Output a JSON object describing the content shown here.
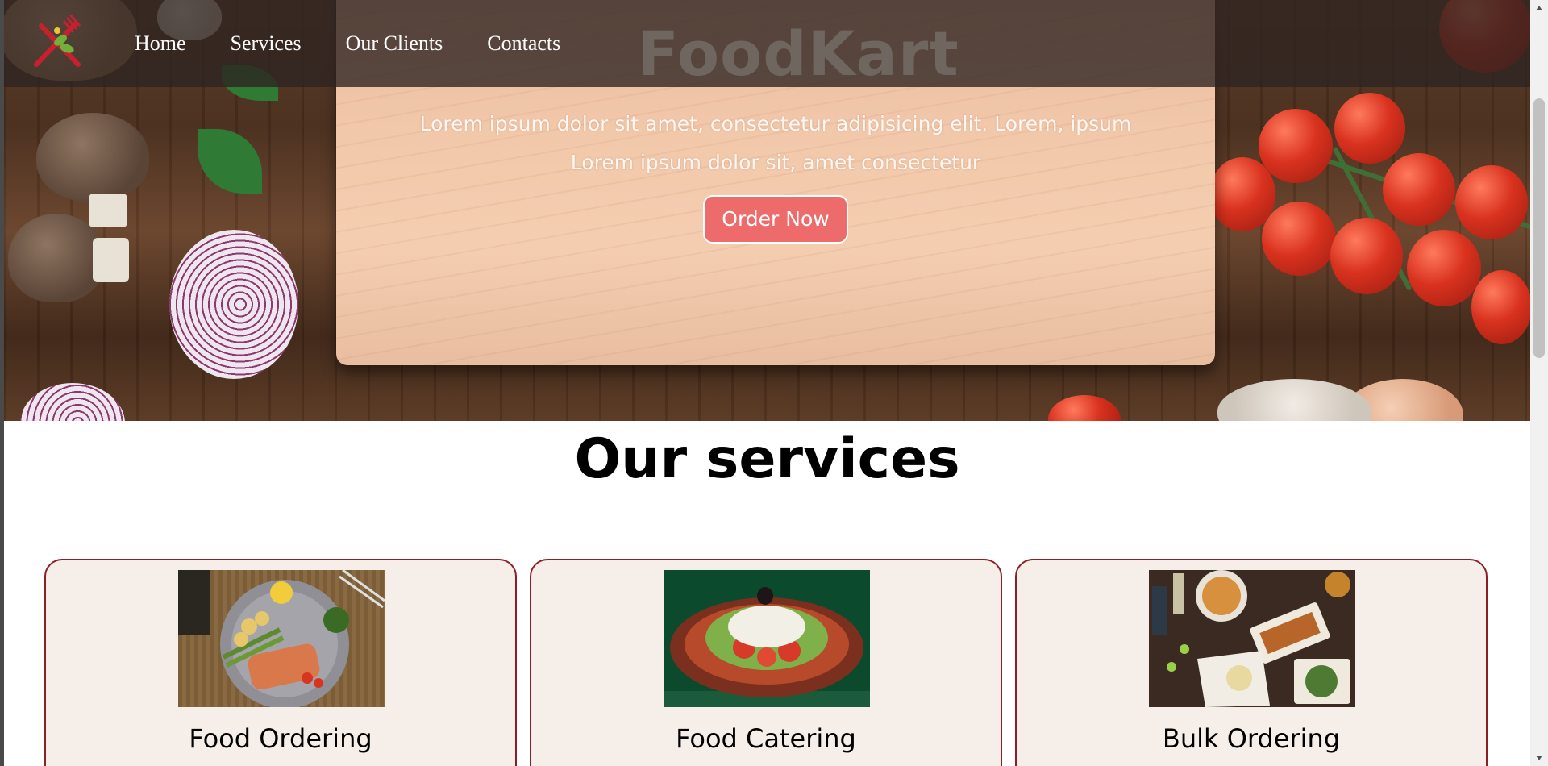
{
  "nav": {
    "items": [
      "Home",
      "Services",
      "Our Clients",
      "Contacts"
    ],
    "brand": "FoodKart"
  },
  "hero": {
    "line1": "Lorem ipsum dolor sit amet, consectetur adipisicing elit. Lorem, ipsum",
    "line2": "Lorem ipsum dolor sit, amet consectetur",
    "button_label": "Order Now"
  },
  "services": {
    "title": "Our services",
    "cards": [
      {
        "title": "Food Ordering"
      },
      {
        "title": "Food Catering"
      },
      {
        "title": "Bulk Ordering"
      }
    ]
  },
  "colors": {
    "accent": "#ee6b6b",
    "card_border": "#8c1e24",
    "card_bg": "#f5eee9",
    "nav_bg": "#2d2220"
  },
  "icons": {
    "logo": "fork-knife-logo-icon",
    "scroll_up": "chevron-up-icon",
    "scroll_down": "chevron-down-icon"
  }
}
